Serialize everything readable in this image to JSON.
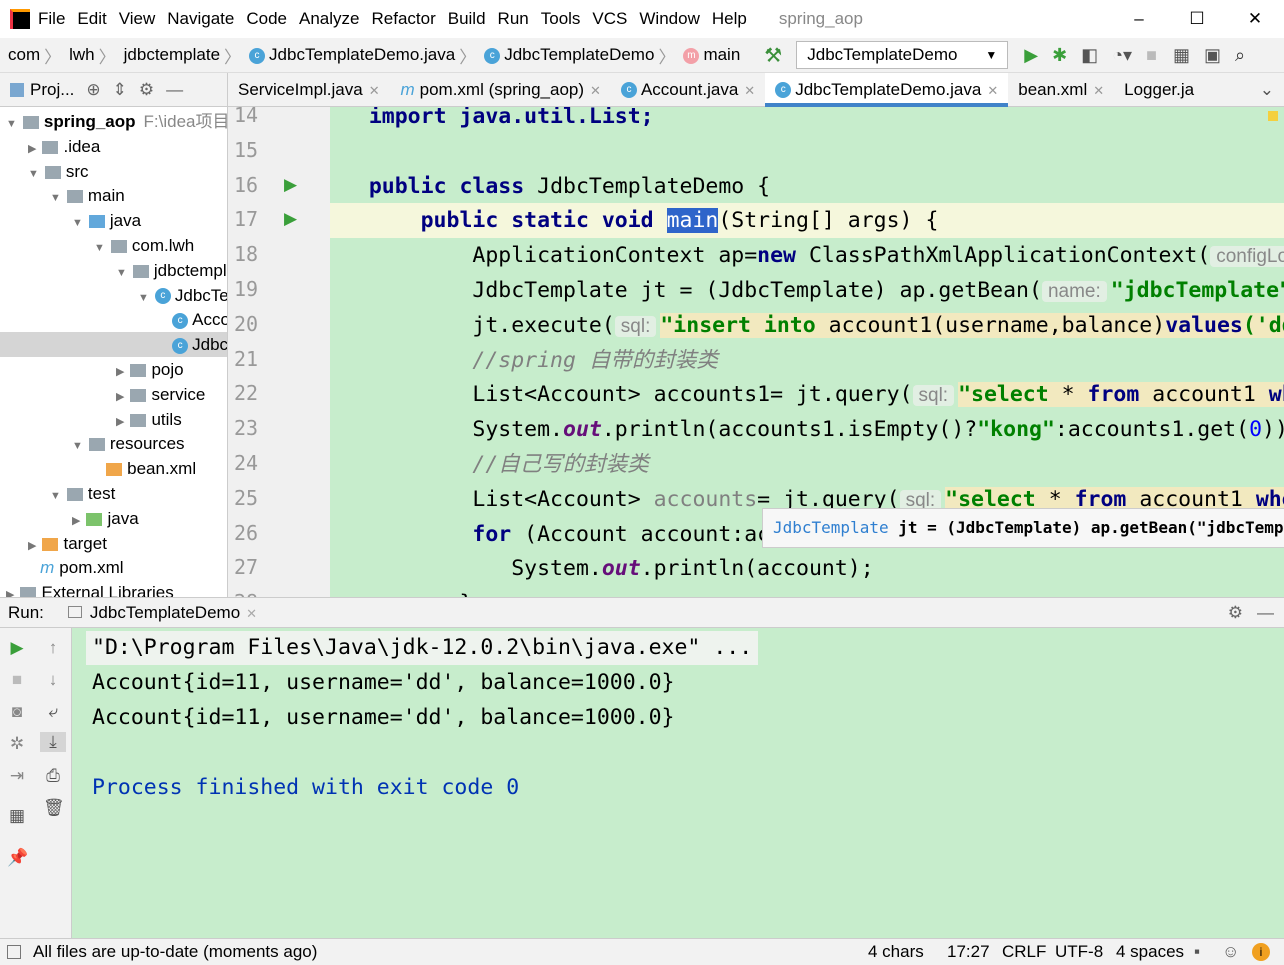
{
  "window": {
    "title": "spring_aop",
    "menu": [
      "File",
      "Edit",
      "View",
      "Navigate",
      "Code",
      "Analyze",
      "Refactor",
      "Build",
      "Run",
      "Tools",
      "VCS",
      "Window",
      "Help"
    ],
    "minimize": "–",
    "maximize": "☐",
    "close": "✕"
  },
  "breadcrumbs": [
    "com",
    "lwh",
    "jdbctemplate",
    "JdbcTemplateDemo.java",
    "JdbcTemplateDemo",
    "main"
  ],
  "run_config": "JdbcTemplateDemo",
  "project_label": "Proj...",
  "tabs": [
    {
      "label": "ServiceImpl.java"
    },
    {
      "label": "pom.xml (spring_aop)",
      "icon": "m"
    },
    {
      "label": "Account.java",
      "icon": "c"
    },
    {
      "label": "JdbcTemplateDemo.java",
      "icon": "c",
      "active": true
    },
    {
      "label": "bean.xml"
    },
    {
      "label": "Logger.ja"
    }
  ],
  "tree": [
    {
      "label": "spring_aop",
      "extra": "F:\\idea项目",
      "indent": 0,
      "arrow": "▼",
      "bold": true
    },
    {
      "label": ".idea",
      "indent": 1,
      "arrow": "▶"
    },
    {
      "label": "src",
      "indent": 1,
      "arrow": "▼"
    },
    {
      "label": "main",
      "indent": 2,
      "arrow": "▼"
    },
    {
      "label": "java",
      "indent": 3,
      "arrow": "▼",
      "color": "blue"
    },
    {
      "label": "com.lwh",
      "indent": 4,
      "arrow": "▼"
    },
    {
      "label": "jdbctemplate",
      "indent": 5,
      "arrow": "▼"
    },
    {
      "label": "JdbcTemplateDemo",
      "indent": 6,
      "arrow": "▼",
      "cls": true
    },
    {
      "label": "Account",
      "indent": 7,
      "cls": true
    },
    {
      "label": "JdbcTemplateDemo",
      "indent": 7,
      "cls": true,
      "selected": true
    },
    {
      "label": "pojo",
      "indent": 5,
      "arrow": "▶"
    },
    {
      "label": "service",
      "indent": 5,
      "arrow": "▶"
    },
    {
      "label": "utils",
      "indent": 5,
      "arrow": "▶"
    },
    {
      "label": "resources",
      "indent": 3,
      "arrow": "▼"
    },
    {
      "label": "bean.xml",
      "indent": 4,
      "xml": true
    },
    {
      "label": "test",
      "indent": 2,
      "arrow": "▼"
    },
    {
      "label": "java",
      "indent": 3,
      "arrow": "▶",
      "color": "green"
    },
    {
      "label": "target",
      "indent": 1,
      "arrow": "▶",
      "color": "orange"
    },
    {
      "label": "pom.xml",
      "indent": 1,
      "pom": true
    },
    {
      "label": "External Libraries",
      "indent": 0,
      "arrow": "▶"
    }
  ],
  "code": [
    {
      "n": 14,
      "ind": 0,
      "segs": [
        [
          "import java.util.List;",
          "kw"
        ]
      ]
    },
    {
      "n": 15,
      "ind": 0,
      "segs": []
    },
    {
      "n": 16,
      "ind": 0,
      "run": true,
      "segs": [
        [
          "public class ",
          "kw"
        ],
        [
          "JdbcTemplateDemo {",
          ""
        ]
      ]
    },
    {
      "n": 17,
      "ind": 4,
      "run": true,
      "cur": true,
      "segs": [
        [
          "public static void ",
          "kw"
        ],
        [
          "main",
          "selw"
        ],
        [
          "(String[] args) {",
          ""
        ]
      ]
    },
    {
      "n": 18,
      "ind": 8,
      "segs": [
        [
          "ApplicationContext ap=",
          ""
        ],
        [
          "new ",
          "kw"
        ],
        [
          "ClassPathXmlApplicationContext(",
          ""
        ],
        [
          "configLocation",
          "hint"
        ]
      ]
    },
    {
      "n": 19,
      "ind": 8,
      "segs": [
        [
          "JdbcTemplate jt = (JdbcTemplate) ap.getBean(",
          ""
        ],
        [
          "name:",
          "hint"
        ],
        [
          "\"jdbcTemplate\"",
          "str"
        ]
      ]
    },
    {
      "n": 20,
      "ind": 8,
      "segs": [
        [
          "jt.execute(",
          ""
        ],
        [
          "sql:",
          "hint"
        ],
        [
          "\"insert into ",
          "str strbg"
        ],
        [
          "account1(username,balance)",
          "strbg"
        ],
        [
          "values",
          "kw strbg"
        ],
        [
          "('dd'",
          "str strbg"
        ]
      ]
    },
    {
      "n": 21,
      "ind": 8,
      "segs": [
        [
          "//spring 自带的封装类",
          "cm"
        ]
      ]
    },
    {
      "n": 22,
      "ind": 8,
      "segs": [
        [
          "List<Account> accounts1= jt.query(",
          ""
        ],
        [
          "sql:",
          "hint"
        ],
        [
          "\"select ",
          "str strbg"
        ],
        [
          "* ",
          "strbg"
        ],
        [
          "from ",
          "kw strbg"
        ],
        [
          "account1 ",
          "strbg"
        ],
        [
          "where",
          "kw strbg"
        ]
      ]
    },
    {
      "n": 23,
      "ind": 8,
      "segs": [
        [
          "System.",
          ""
        ],
        [
          "out",
          "it"
        ],
        [
          ".println(accounts1.isEmpty()?",
          ""
        ],
        [
          "\"kong\"",
          "str"
        ],
        [
          ":accounts1.get(",
          ""
        ],
        [
          "0",
          "num"
        ],
        [
          "));",
          ""
        ]
      ]
    },
    {
      "n": 24,
      "ind": 8,
      "segs": [
        [
          "//自己写的封装类",
          "cm"
        ]
      ]
    },
    {
      "n": 25,
      "ind": 8,
      "segs": [
        [
          "List<Account> ",
          ""
        ],
        [
          "accounts",
          "gr"
        ],
        [
          "= jt.query(",
          ""
        ],
        [
          "sql:",
          "hint"
        ],
        [
          "\"select ",
          "str strbg"
        ],
        [
          "* ",
          "strbg"
        ],
        [
          "from ",
          "kw strbg"
        ],
        [
          "account1 ",
          "strbg"
        ],
        [
          "where",
          "kw strbg"
        ]
      ]
    },
    {
      "n": 26,
      "ind": 8,
      "segs": [
        [
          "for ",
          "kw"
        ],
        [
          "(Account account:accounts)",
          ""
        ]
      ]
    },
    {
      "n": 27,
      "ind": 11,
      "segs": [
        [
          "System.",
          ""
        ],
        [
          "out",
          "it"
        ],
        [
          ".println(account);",
          ""
        ]
      ]
    },
    {
      "n": 28,
      "ind": 7,
      "segs": [
        [
          "}",
          ""
        ]
      ]
    }
  ],
  "tooltip": {
    "type": "JdbcTemplate",
    "rest": " jt = (JdbcTemplate) ap.getBean(\"jdbcTemplate\");"
  },
  "run": {
    "label": "Run:",
    "tab": "JdbcTemplateDemo",
    "console": [
      {
        "t": "\"D:\\Program Files\\Java\\jdk-12.0.2\\bin\\java.exe\" ...",
        "c": "cmd"
      },
      {
        "t": "Account{id=11, username='dd', balance=1000.0}",
        "c": ""
      },
      {
        "t": "Account{id=11, username='dd', balance=1000.0}",
        "c": ""
      },
      {
        "t": "",
        "c": ""
      },
      {
        "t": "Process finished with exit code 0",
        "c": "exit"
      }
    ]
  },
  "status": {
    "message": "All files are up-to-date (moments ago)",
    "chars": "4 chars",
    "position": "17:27",
    "line_sep": "CRLF",
    "encoding": "UTF-8",
    "indent": "4 spaces"
  }
}
